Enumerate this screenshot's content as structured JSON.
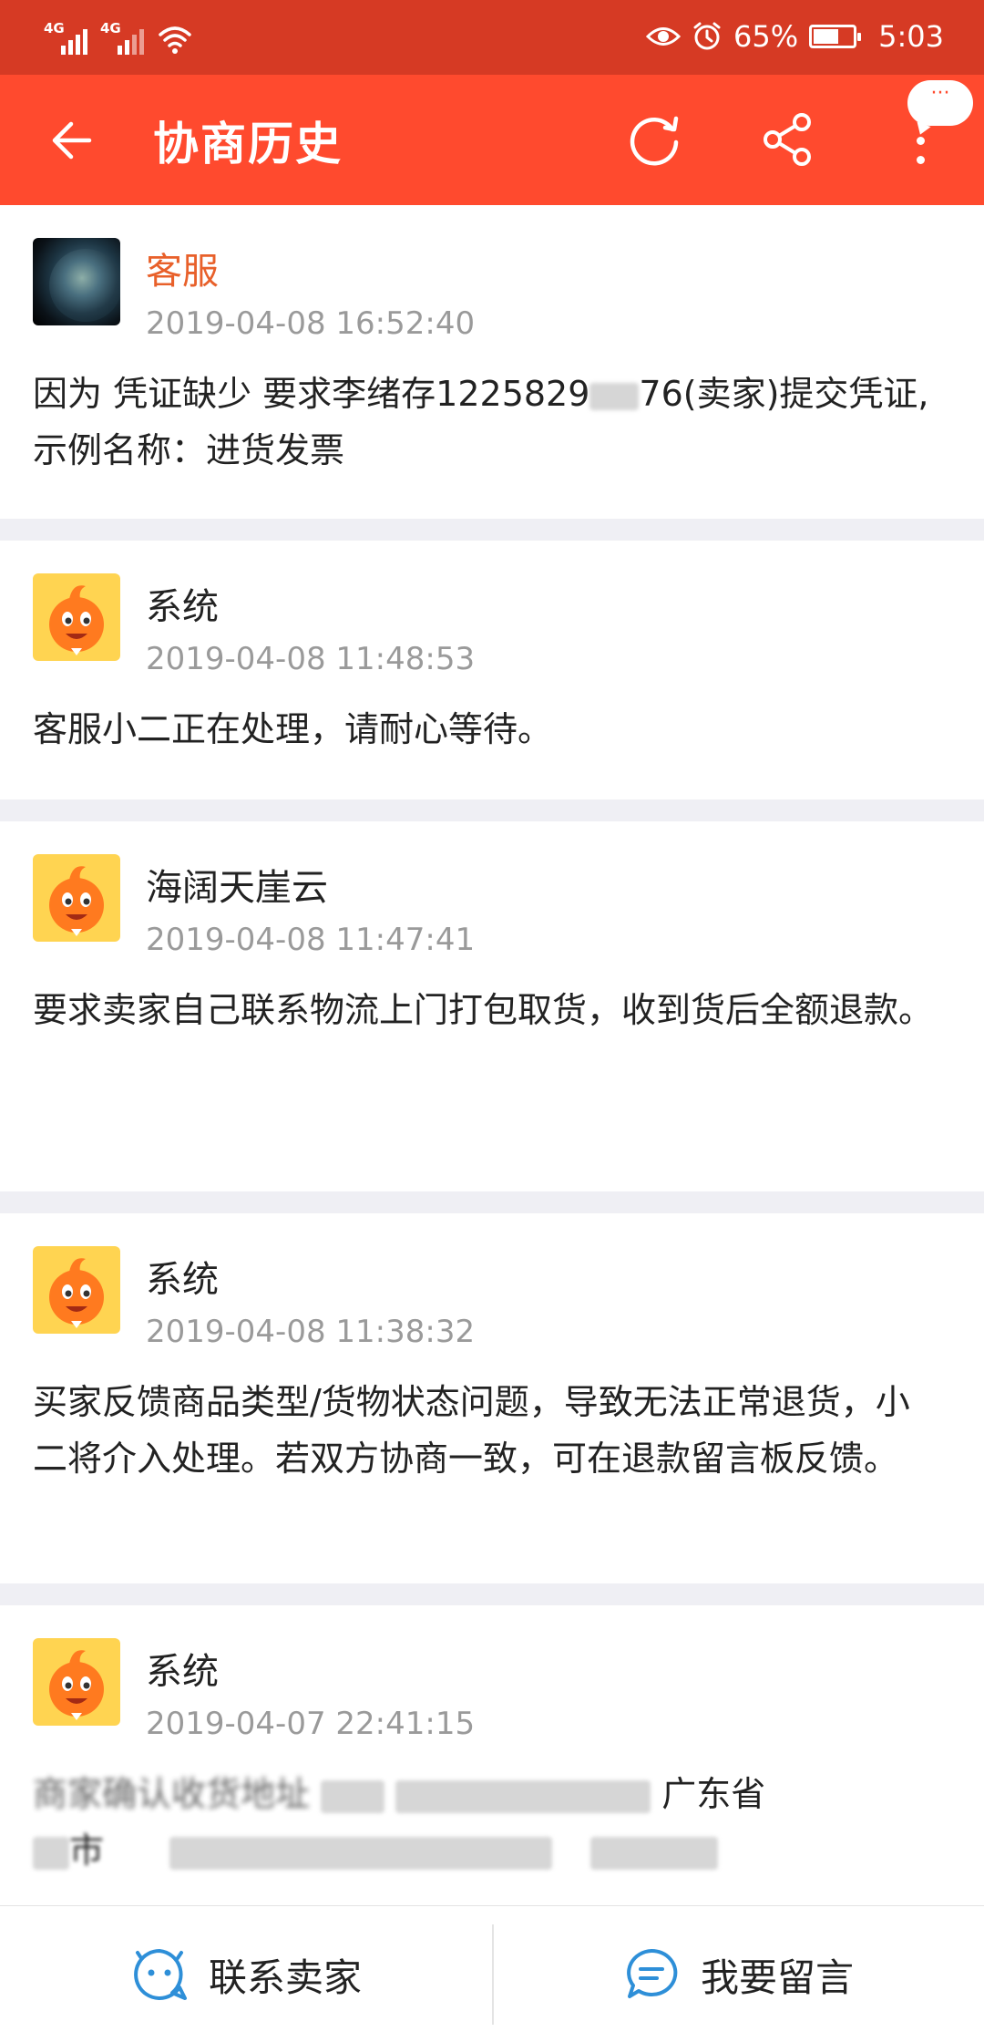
{
  "status_bar": {
    "network1": "4G",
    "network2": "4G",
    "battery_text": "65%",
    "battery_level": 0.65,
    "time": "5:03",
    "icons": [
      "signal-icon",
      "signal-icon",
      "wifi-icon",
      "eye-icon",
      "alarm-icon",
      "battery-icon"
    ]
  },
  "app_bar": {
    "title": "协商历史",
    "more_badge": "···",
    "icons": [
      "back-arrow-icon",
      "refresh-icon",
      "share-icon",
      "more-vertical-icon"
    ]
  },
  "messages": [
    {
      "sender": "客服",
      "time": "2019-04-08 16:52:40",
      "text_parts": [
        "因为  凭证缺少  要求李绪存1225829",
        "76(卖家)提交凭证,示例名称：进货发票"
      ],
      "avatar": "earth"
    },
    {
      "sender": "系统",
      "time": "2019-04-08 11:48:53",
      "text": "客服小二正在处理，请耐心等待。",
      "avatar": "mascot"
    },
    {
      "sender": "海阔天崖云",
      "time": "2019-04-08 11:47:41",
      "text": "要求卖家自己联系物流上门打包取货，收到货后全额退款。",
      "avatar": "mascot"
    },
    {
      "sender": "系统",
      "time": "2019-04-08 11:38:32",
      "text": "买家反馈商品类型/货物状态问题，导致无法正常退货，小二将介入处理。若双方协商一致，可在退款留言板反馈。",
      "avatar": "mascot"
    },
    {
      "sender": "系统",
      "time": "2019-04-07 22:41:15",
      "text_parts": [
        "商家确认收货地址",
        "广东省",
        "市"
      ],
      "avatar": "mascot"
    }
  ],
  "bottom_bar": {
    "contact_seller": "联系卖家",
    "leave_message": "我要留言",
    "icons": [
      "smiley-chat-icon",
      "chat-bubble-icon"
    ]
  },
  "colors": {
    "status_bar": "#d63a24",
    "app_bar": "#ff4a2e",
    "cs_name": "#e8602a",
    "timestamp": "#9a9a9a",
    "bottom_icon": "#2e8fd8"
  }
}
